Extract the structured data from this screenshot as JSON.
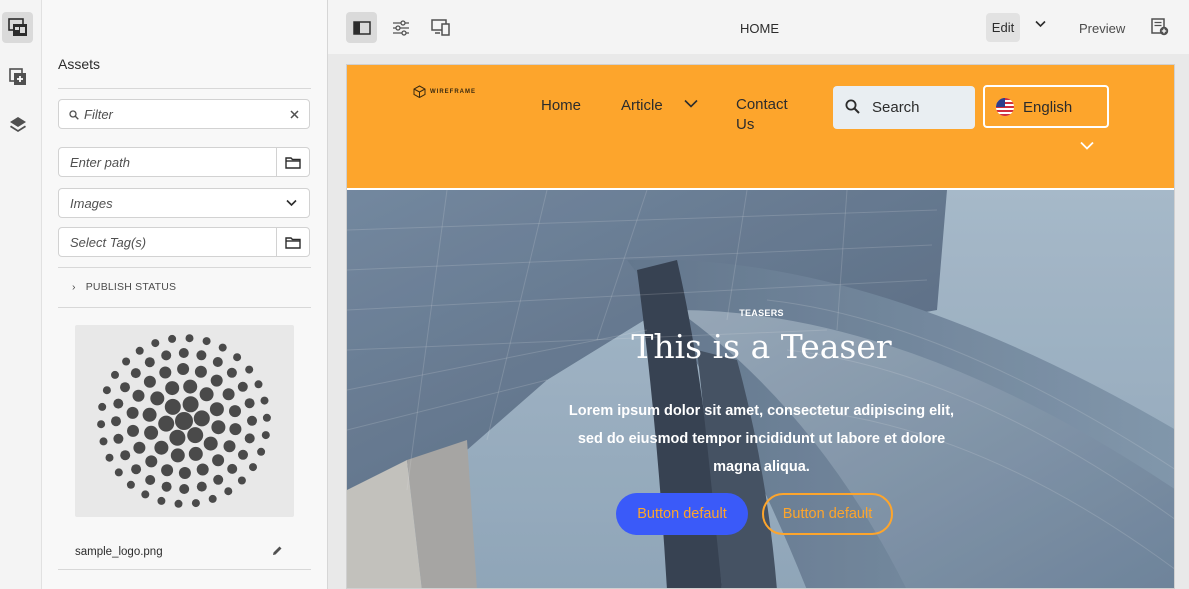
{
  "rail": {
    "items": [
      {
        "icon": "assets-panel-icon"
      },
      {
        "icon": "components-icon"
      },
      {
        "icon": "layers-icon"
      }
    ]
  },
  "assets_panel": {
    "title": "Assets",
    "filter_placeholder": "Filter",
    "path_placeholder": "Enter path",
    "type_select": "Images",
    "tags_placeholder": "Select Tag(s)",
    "publish_status_label": "PUBLISH STATUS",
    "asset_name": "sample_logo.png"
  },
  "toolbar": {
    "page_title": "HOME",
    "edit_label": "Edit",
    "preview_label": "Preview"
  },
  "site": {
    "logo_text": "WIREFRAME",
    "nav": {
      "home": "Home",
      "article": "Article",
      "contact": "Contact Us"
    },
    "search_placeholder": "Search",
    "language": "English",
    "accent_color": "#fda52c"
  },
  "teaser": {
    "label": "TEASERS",
    "title": "This is a Teaser",
    "text": "Lorem ipsum dolor sit amet, consectetur adipiscing elit, sed do eiusmod tempor incididunt ut labore et dolore magna aliqua.",
    "button_primary": "Button default",
    "button_secondary": "Button default",
    "button_primary_color": "#3a5af9"
  }
}
